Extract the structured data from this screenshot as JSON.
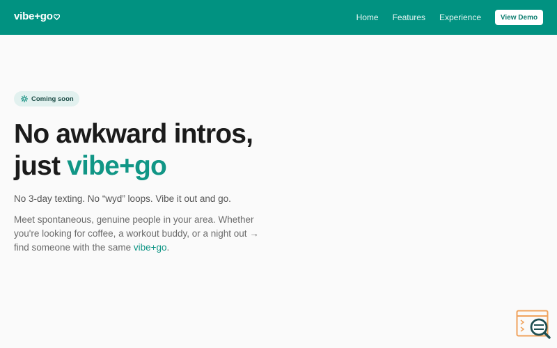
{
  "nav": {
    "logo": "vibe+go",
    "links": [
      "Home",
      "Features",
      "Experience"
    ],
    "cta": "View Demo"
  },
  "hero": {
    "badge": "Coming soon",
    "headline_line1": "No awkward intros,",
    "headline_line2_prefix": "just ",
    "headline_accent": "vibe+go",
    "sub1": "No 3-day texting. No “wyd” loops. Vibe it out and go.",
    "sub2_text": "Meet spontaneous, genuine people in your area. Whether you're looking for coffee, a workout buddy, or a night out → find someone with the same ",
    "sub2_accent": "vibe+go",
    "sub2_end": "."
  },
  "colors": {
    "brand": "#019281",
    "accent": "#119686",
    "badge_bg": "#e2f1ef",
    "widget": "#f0a25c"
  },
  "icons": {
    "badge": "sparkle-icon",
    "logo_mark": "heart-icon",
    "widget": "search-window-icon"
  }
}
